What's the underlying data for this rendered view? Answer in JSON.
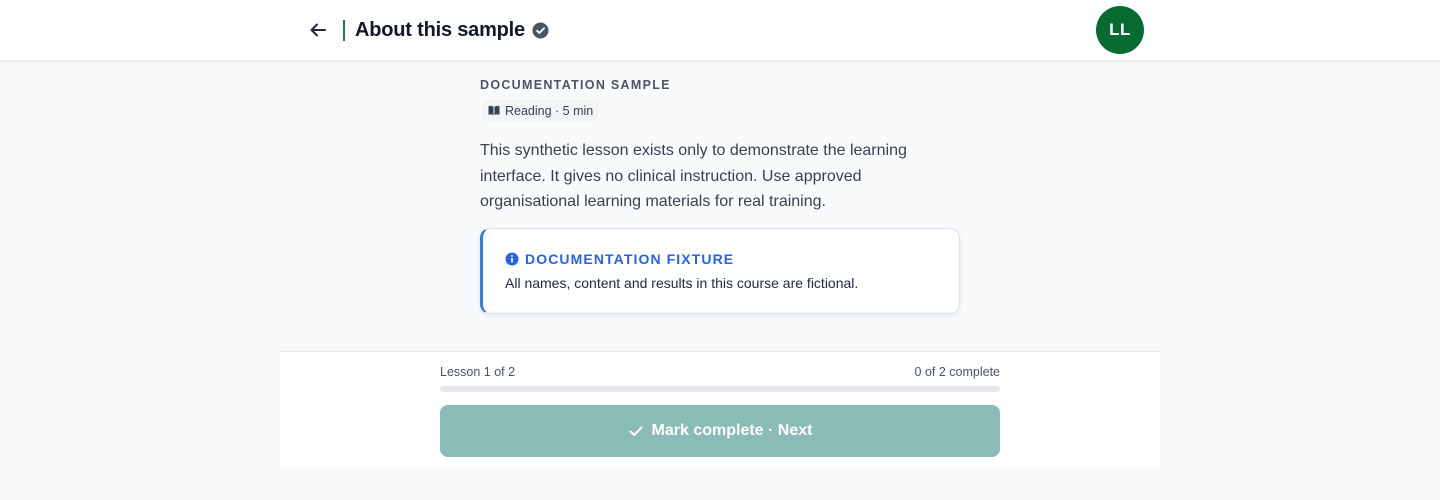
{
  "header": {
    "title": "About this sample",
    "back_icon": "arrow-left-icon",
    "verified_icon": "check-circle-icon",
    "avatar_initials": "LL",
    "accent": "#0f8a3a",
    "avatar_color": "#066b30"
  },
  "lesson": {
    "eyebrow": "DOCUMENTATION SAMPLE",
    "meta_icon": "book-icon",
    "meta": "Reading · 5 min",
    "body": "This synthetic lesson exists only to demonstrate the learning interface. It gives no clinical instruction. Use approved organisational learning materials for real training.",
    "callout": {
      "icon": "info-icon",
      "title": "DOCUMENTATION FIXTURE",
      "text": "All names, content and results in this course are fictional.",
      "accent": "#2f7de1"
    }
  },
  "footer": {
    "lesson_counter": "Lesson 1 of 2",
    "complete_counter": "0 of 2 complete",
    "progress_fraction": 0,
    "button_icon": "check-icon",
    "button_label": "Mark complete · Next",
    "button_disabled": true,
    "button_color": "#8bbbb6"
  }
}
